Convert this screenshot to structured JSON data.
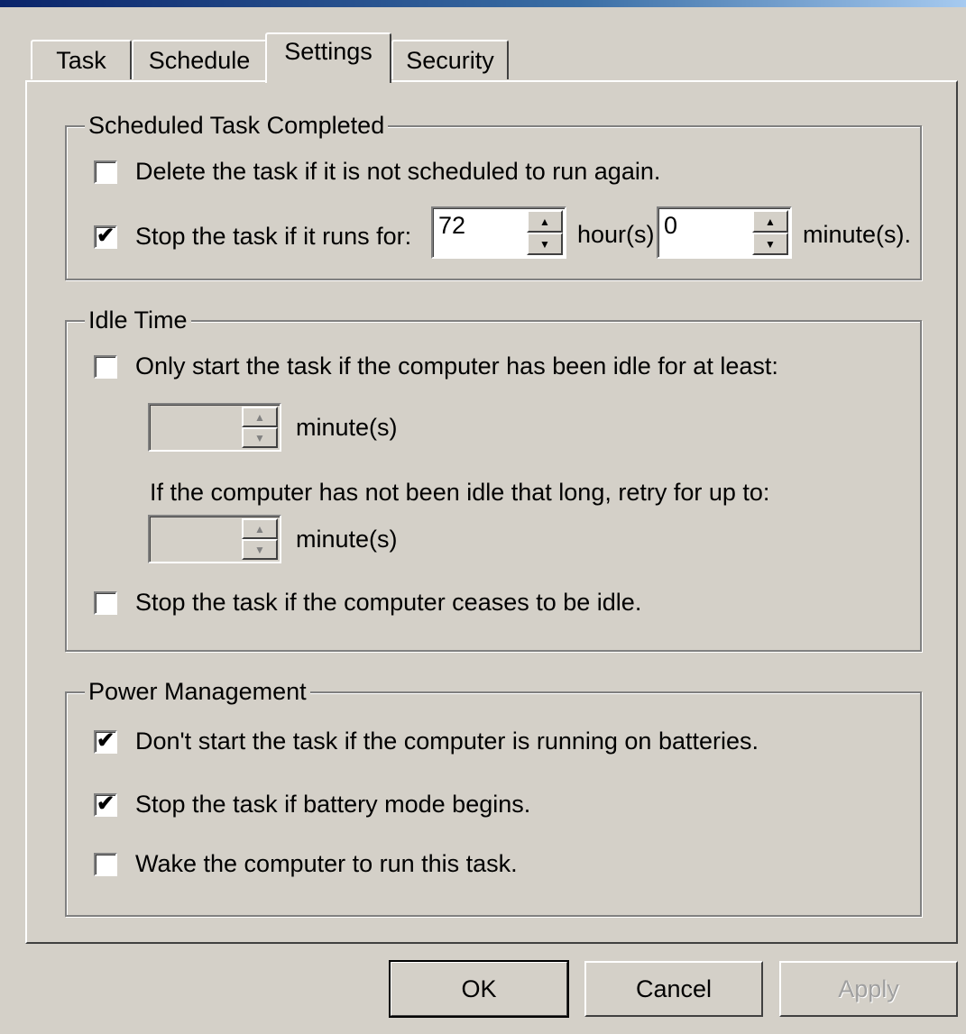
{
  "tabs": [
    "Task",
    "Schedule",
    "Settings",
    "Security"
  ],
  "active_tab": "Settings",
  "completed": {
    "legend": "Scheduled Task Completed",
    "delete_label": "Delete the task if it is not scheduled to run again.",
    "delete_checked": false,
    "stop_label": "Stop the task if it runs for:",
    "stop_checked": true,
    "hours_value": "72",
    "hours_unit": "hour(s)",
    "minutes_value": "0",
    "minutes_unit": "minute(s)."
  },
  "idle": {
    "legend": "Idle Time",
    "only_start_label": "Only start the task if the computer has been idle for at least:",
    "only_start_checked": false,
    "idle_minutes_unit": "minute(s)",
    "retry_label": "If the computer has not been idle that long, retry for up to:",
    "retry_minutes_unit": "minute(s)",
    "stop_idle_label": "Stop the task if the computer ceases to be idle.",
    "stop_idle_checked": false
  },
  "power": {
    "legend": "Power Management",
    "no_batteries_label": "Don't start the task if the computer is running on batteries.",
    "no_batteries_checked": true,
    "stop_battery_label": "Stop the task if battery mode begins.",
    "stop_battery_checked": true,
    "wake_label": "Wake the computer to run this task.",
    "wake_checked": false
  },
  "buttons": {
    "ok": "OK",
    "cancel": "Cancel",
    "apply": "Apply"
  },
  "colors": {
    "face": "#d4d0c8",
    "shadow": "#808080",
    "highlight": "#ffffff",
    "disabled_text": "#a0a0a0"
  },
  "icons": {
    "check": "checkmark-icon",
    "spin_up": "spin-up-arrow-icon",
    "spin_down": "spin-down-arrow-icon"
  }
}
